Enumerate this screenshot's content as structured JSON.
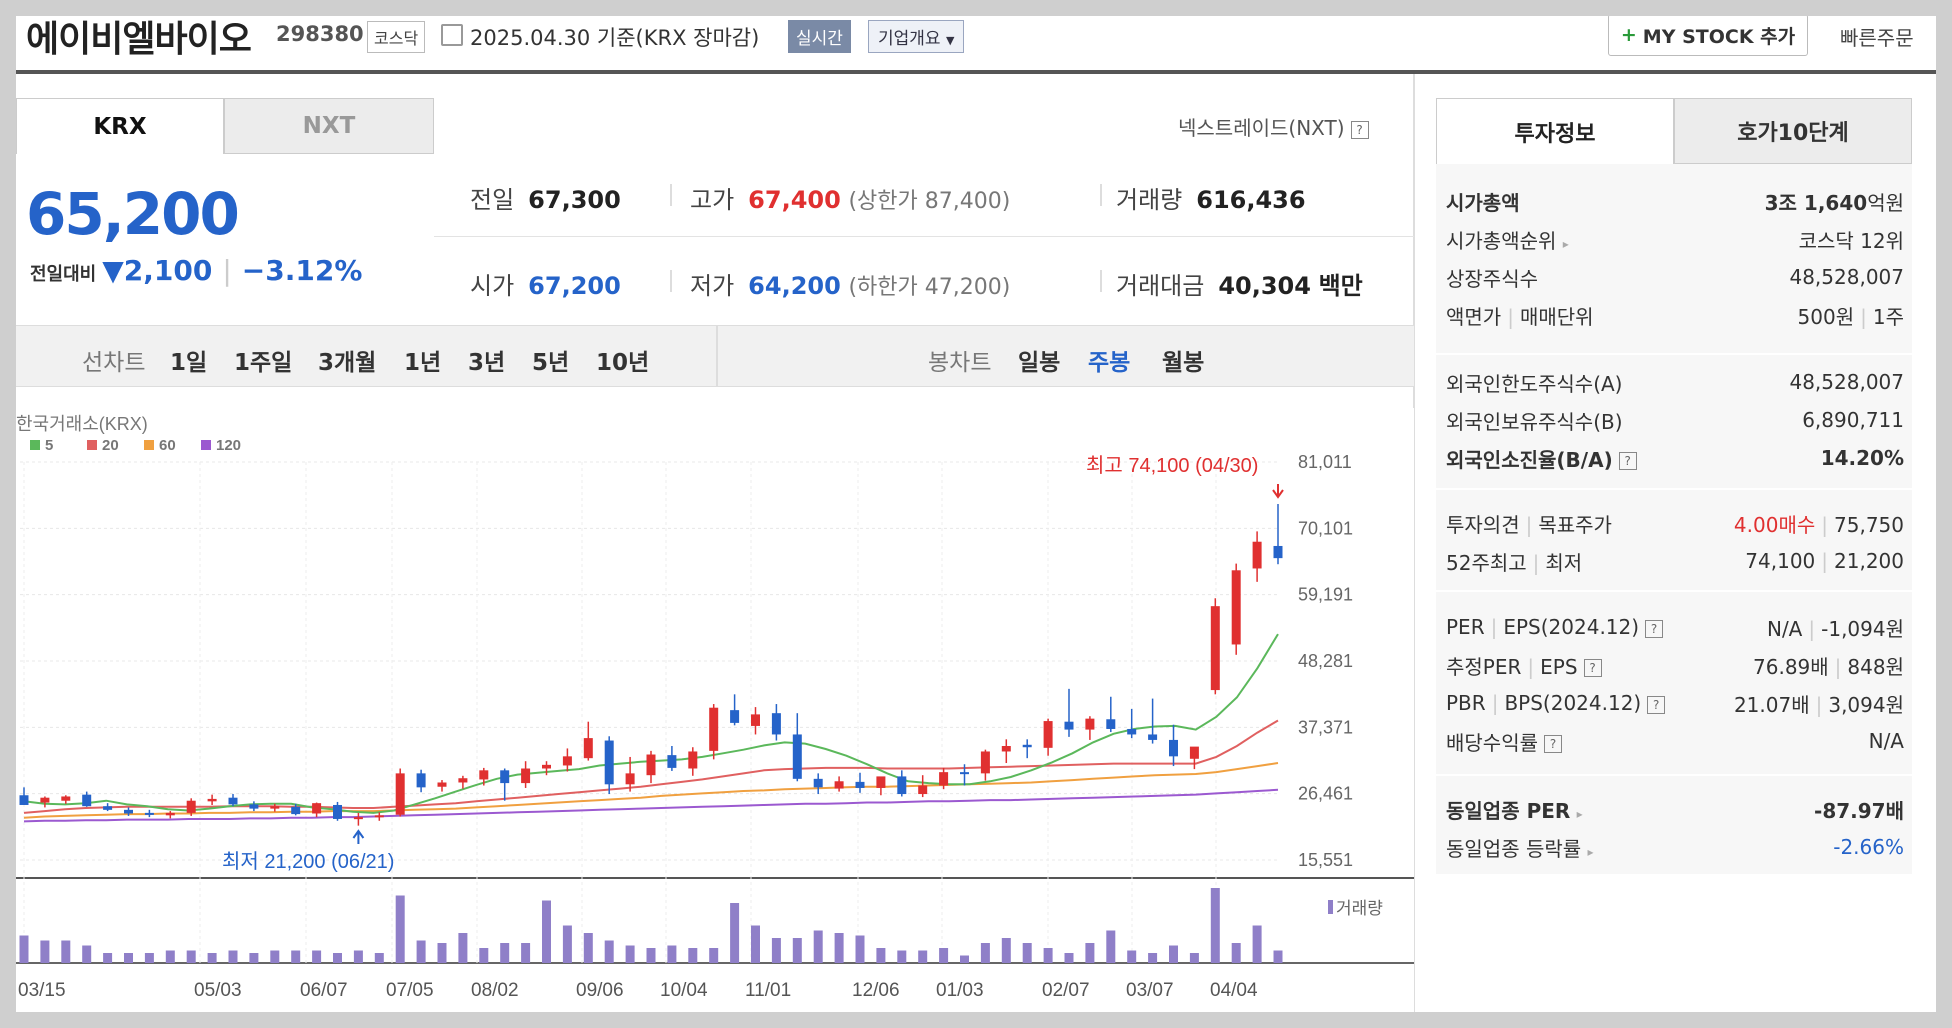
{
  "header": {
    "name": "에이비엘바이오",
    "code": "298380",
    "market": "코스닥",
    "date_text": "2025.04.30 기준(KRX 장마감)",
    "realtime_label": "실시간",
    "corp_label": "기업개요",
    "mystock_label": "MY STOCK 추가",
    "quick_label": "빠른주문"
  },
  "tabs": {
    "krx": "KRX",
    "nxt": "NXT",
    "nxt_link": "넥스트레이드(NXT)"
  },
  "quote": {
    "price": "65,200",
    "change_label": "전일대비",
    "change": "▼2,100",
    "change_pct": "−3.12%",
    "prev_label": "전일",
    "prev": "67,300",
    "high_label": "고가",
    "high": "67,400",
    "upper_limit": "(상한가 87,400)",
    "volume_label": "거래량",
    "volume": "616,436",
    "open_label": "시가",
    "open": "67,200",
    "low_label": "저가",
    "low": "64,200",
    "lower_limit": "(하한가 47,200)",
    "amount_label": "거래대금",
    "amount": "40,304",
    "amount_unit": "백만"
  },
  "periods": {
    "line_label": "선차트",
    "items": [
      "1일",
      "1주일",
      "3개월",
      "1년",
      "3년",
      "5년",
      "10년"
    ],
    "candle_label": "봉차트",
    "candle_items": [
      "일봉",
      "주봉",
      "월봉"
    ],
    "selected": "주봉"
  },
  "right": {
    "tab1": "투자정보",
    "tab2": "호가10단계",
    "rows": [
      {
        "k": "시가총액",
        "v": "3조 1,640억원"
      },
      {
        "k": "시가총액순위",
        "v": "코스닥 12위"
      },
      {
        "k": "상장주식수",
        "v": "48,528,007"
      },
      {
        "k": "액면가",
        "k2": "매매단위",
        "v": "500원",
        "v2": "1주"
      },
      {
        "k": "외국인한도주식수(A)",
        "v": "48,528,007"
      },
      {
        "k": "외국인보유주식수(B)",
        "v": "6,890,711"
      },
      {
        "k": "외국인소진율(B/A)",
        "v": "14.20%"
      },
      {
        "k": "투자의견",
        "k2": "목표주가",
        "v": "4.00매수",
        "v2": "75,750"
      },
      {
        "k": "52주최고",
        "k2": "최저",
        "v": "74,100",
        "v2": "21,200"
      },
      {
        "k": "PER",
        "k2": "EPS(2024.12)",
        "v": "N/A",
        "v2": "-1,094원"
      },
      {
        "k": "추정PER",
        "k2": "EPS",
        "v": "76.89배",
        "v2": "848원"
      },
      {
        "k": "PBR",
        "k2": "BPS(2024.12)",
        "v": "21.07배",
        "v2": "3,094원"
      },
      {
        "k": "배당수익률",
        "v": "N/A"
      },
      {
        "k": "동일업종 PER",
        "v": "-87.97배"
      },
      {
        "k": "동일업종 등락률",
        "v": "-2.66%"
      }
    ]
  },
  "colors": {
    "up": "#e03030",
    "down": "#2563c9",
    "ma5": "#5bb85b",
    "ma20": "#e06060",
    "ma60": "#f0a040",
    "ma120": "#9b59d0",
    "volume": "#8f7fc8"
  },
  "chart_data": {
    "type": "candlestick",
    "title": "한국거래소(KRX)",
    "legend": [
      "5",
      "20",
      "60",
      "120"
    ],
    "y_ticks": [
      81011,
      70101,
      59191,
      48281,
      37371,
      26461,
      15551
    ],
    "ylim": [
      15551,
      81011
    ],
    "x_ticks": [
      "03/15",
      "05/03",
      "06/07",
      "07/05",
      "08/02",
      "09/06",
      "10/04",
      "11/01",
      "12/06",
      "01/03",
      "02/07",
      "03/07",
      "04/04"
    ],
    "high_note": "최고 74,100 (04/30)",
    "low_note": "최저 21,200 (06/21)",
    "volume_label": "거래량",
    "candles": [
      [
        26200,
        27500,
        24600,
        24600
      ],
      [
        25000,
        26000,
        24200,
        25800
      ],
      [
        25300,
        26200,
        24800,
        26000
      ],
      [
        26300,
        26800,
        24300,
        24400
      ],
      [
        24400,
        24900,
        23600,
        23800
      ],
      [
        23800,
        24200,
        22800,
        23200
      ],
      [
        23300,
        23800,
        22600,
        23100
      ],
      [
        22900,
        23600,
        22400,
        23300
      ],
      [
        23300,
        25700,
        22800,
        25300
      ],
      [
        25200,
        26300,
        24600,
        25600
      ],
      [
        25800,
        26400,
        24400,
        24700
      ],
      [
        24700,
        25200,
        23600,
        24000
      ],
      [
        24000,
        24800,
        23500,
        24400
      ],
      [
        24300,
        24800,
        22900,
        23100
      ],
      [
        23200,
        25000,
        22600,
        24900
      ],
      [
        24600,
        25100,
        22000,
        22300
      ],
      [
        22300,
        23300,
        21200,
        22600
      ],
      [
        22600,
        23400,
        22000,
        22900
      ],
      [
        23000,
        30600,
        22700,
        29800
      ],
      [
        29800,
        30400,
        26700,
        27500
      ],
      [
        27600,
        28700,
        26800,
        28300
      ],
      [
        28300,
        29400,
        27300,
        29000
      ],
      [
        28800,
        30700,
        27800,
        30300
      ],
      [
        30300,
        30600,
        25300,
        28200
      ],
      [
        28200,
        31800,
        27400,
        30600
      ],
      [
        30600,
        31800,
        29500,
        31200
      ],
      [
        31100,
        33900,
        30100,
        32600
      ],
      [
        32300,
        38300,
        31900,
        35600
      ],
      [
        35200,
        35900,
        26400,
        28000
      ],
      [
        28000,
        32500,
        26800,
        29800
      ],
      [
        29500,
        33500,
        28200,
        32900
      ],
      [
        32800,
        34300,
        30200,
        30700
      ],
      [
        30600,
        34100,
        29400,
        33400
      ],
      [
        33500,
        41200,
        32100,
        40600
      ],
      [
        40200,
        42800,
        37700,
        38100
      ],
      [
        37600,
        40700,
        36200,
        39500
      ],
      [
        39700,
        41200,
        35200,
        36200
      ],
      [
        36200,
        39700,
        28500,
        28900
      ],
      [
        28900,
        29800,
        26400,
        27500
      ],
      [
        27300,
        29300,
        26800,
        28500
      ],
      [
        28400,
        29900,
        26600,
        27400
      ],
      [
        27400,
        28800,
        26200,
        29300
      ],
      [
        29300,
        30300,
        26000,
        26400
      ],
      [
        26400,
        29500,
        25900,
        27800
      ],
      [
        27800,
        30700,
        27200,
        30000
      ],
      [
        30000,
        31300,
        27800,
        29800
      ],
      [
        29800,
        33700,
        28600,
        33400
      ],
      [
        33400,
        35400,
        31500,
        34300
      ],
      [
        34500,
        35400,
        32300,
        34100
      ],
      [
        34000,
        38800,
        32700,
        38400
      ],
      [
        38300,
        43700,
        35800,
        37000
      ],
      [
        37000,
        39200,
        35300,
        38800
      ],
      [
        38700,
        42400,
        36600,
        37100
      ],
      [
        37100,
        40400,
        35600,
        36200
      ],
      [
        36200,
        42100,
        34700,
        35300
      ],
      [
        35300,
        37800,
        31000,
        32600
      ],
      [
        32200,
        33700,
        30500,
        34200
      ],
      [
        43500,
        58600,
        42800,
        57300
      ],
      [
        51000,
        64300,
        49300,
        63200
      ],
      [
        63500,
        69600,
        61300,
        67900
      ],
      [
        67200,
        74100,
        64200,
        65200
      ]
    ],
    "volume": [
      11,
      9,
      9,
      7,
      4,
      4,
      4,
      5,
      5,
      4,
      5,
      4,
      5,
      5,
      5,
      4,
      5,
      4,
      27,
      9,
      8,
      12,
      6,
      8,
      8,
      25,
      15,
      12,
      9,
      7,
      6,
      7,
      6,
      6,
      24,
      15,
      10,
      10,
      13,
      12,
      11,
      6,
      5,
      5,
      6,
      3,
      8,
      10,
      8,
      6,
      4,
      8,
      13,
      5,
      4,
      7,
      4,
      30,
      8,
      15,
      5
    ],
    "ma5": [
      25200,
      24800,
      24700,
      24900,
      25300,
      24700,
      24400,
      23900,
      23700,
      24000,
      24400,
      24700,
      24800,
      24800,
      24200,
      23900,
      23500,
      23300,
      23700,
      24700,
      25700,
      26800,
      27900,
      28900,
      29600,
      29900,
      30200,
      30500,
      31100,
      31400,
      31700,
      31900,
      32100,
      32500,
      33100,
      33700,
      34400,
      34900,
      34700,
      33800,
      32700,
      31300,
      29800,
      28500,
      28200,
      28000,
      28000,
      28500,
      29200,
      30300,
      31600,
      33100,
      34900,
      36300,
      37100,
      37500,
      37600,
      37000,
      39100,
      42300,
      47100,
      52700
    ],
    "ma20": [
      23300,
      23600,
      23900,
      24100,
      24200,
      24300,
      24300,
      24300,
      24300,
      24300,
      24400,
      24400,
      24400,
      24300,
      24300,
      24200,
      24100,
      24100,
      24300,
      24500,
      24700,
      24900,
      25200,
      25500,
      25800,
      26100,
      26400,
      26700,
      27000,
      27300,
      27600,
      28000,
      28400,
      28800,
      29300,
      29800,
      30300,
      30500,
      30600,
      30700,
      30700,
      30700,
      30600,
      30600,
      30600,
      30600,
      30700,
      30800,
      30900,
      31000,
      31100,
      31200,
      31300,
      31400,
      31400,
      31400,
      31400,
      31400,
      32500,
      34300,
      36500,
      38500
    ],
    "ma60": [
      22500,
      22700,
      22800,
      22900,
      23000,
      23100,
      23100,
      23200,
      23200,
      23300,
      23300,
      23400,
      23400,
      23500,
      23500,
      23600,
      23600,
      23600,
      23700,
      23800,
      23900,
      24000,
      24200,
      24400,
      24600,
      24800,
      25000,
      25200,
      25400,
      25600,
      25800,
      26100,
      26300,
      26500,
      26700,
      26900,
      27000,
      27200,
      27300,
      27400,
      27500,
      27600,
      27600,
      27700,
      27800,
      27900,
      28000,
      28100,
      28200,
      28300,
      28500,
      28700,
      28900,
      29100,
      29300,
      29500,
      29600,
      29700,
      30000,
      30500,
      31000,
      31500
    ],
    "ma120": [
      21900,
      22000,
      22000,
      22100,
      22100,
      22200,
      22200,
      22200,
      22300,
      22300,
      22300,
      22400,
      22400,
      22500,
      22500,
      22600,
      22600,
      22700,
      22800,
      22900,
      23000,
      23100,
      23200,
      23300,
      23400,
      23500,
      23600,
      23700,
      23800,
      23900,
      24000,
      24100,
      24200,
      24300,
      24400,
      24500,
      24600,
      24700,
      24800,
      24800,
      24900,
      25000,
      25000,
      25100,
      25200,
      25200,
      25300,
      25400,
      25400,
      25500,
      25600,
      25700,
      25800,
      25900,
      26000,
      26100,
      26200,
      26300,
      26500,
      26700,
      26900,
      27100
    ]
  }
}
